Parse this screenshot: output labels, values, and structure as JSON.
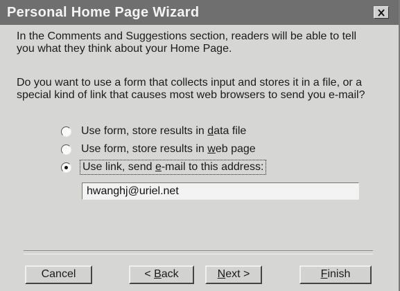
{
  "window": {
    "title": "Personal Home Page Wizard",
    "close_icon": "close-icon"
  },
  "content": {
    "paragraph1": "In the Comments and Suggestions section, readers will be able to tell you what they think about your Home Page.",
    "paragraph2": "Do you want to use a form that collects input and stores it in a file, or a special kind of link that causes most web browsers to send you e-mail?"
  },
  "options": [
    {
      "label_before": "Use form, store results in ",
      "mnemonic": "d",
      "label_after": "ata file",
      "checked": false
    },
    {
      "label_before": "Use form, store results in ",
      "mnemonic": "w",
      "label_after": "eb page",
      "checked": false
    },
    {
      "label_before": "Use link, send ",
      "mnemonic": "e",
      "label_after": "-mail to this address:",
      "checked": true
    }
  ],
  "email": {
    "value": "hwanghj@uriel.net"
  },
  "buttons": {
    "cancel": "Cancel",
    "back_prefix": "< ",
    "back_mnemonic": "B",
    "back_rest": "ack",
    "next_mnemonic": "N",
    "next_rest": "ext >",
    "finish_mnemonic": "F",
    "finish_rest": "inish"
  }
}
